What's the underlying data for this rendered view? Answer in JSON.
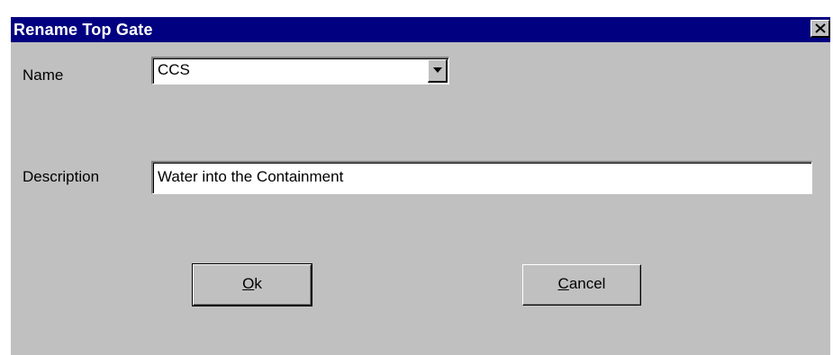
{
  "dialog": {
    "title": "Rename Top Gate",
    "close_icon": "close-icon"
  },
  "name_field": {
    "label": "Name",
    "value": "CCS",
    "dropdown_icon": "chevron-down-icon"
  },
  "description_field": {
    "label": "Description",
    "value": "Water into the Containment"
  },
  "buttons": {
    "ok": {
      "accelerator": "O",
      "rest": "k"
    },
    "cancel": {
      "accelerator": "C",
      "rest": "ancel"
    }
  },
  "colors": {
    "titlebar": "#000080",
    "face": "#c0c0c0",
    "title_text": "#ffffff"
  }
}
